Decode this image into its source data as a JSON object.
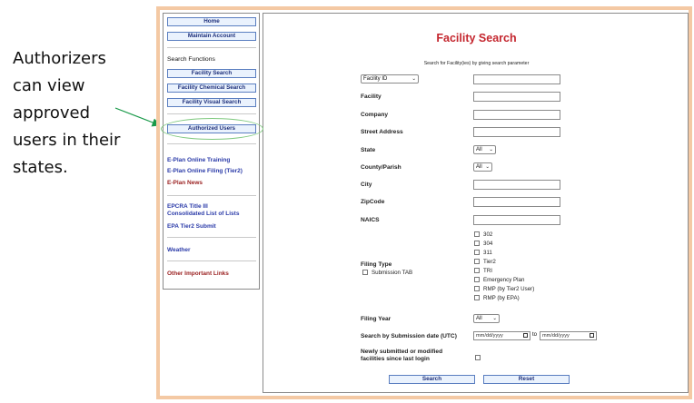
{
  "callout": {
    "lines": [
      "Authorizers",
      "can view",
      "approved",
      "users in their",
      "states."
    ]
  },
  "sidebar": {
    "home": "Home",
    "maintain_account": "Maintain Account",
    "search_functions_heading": "Search Functions",
    "facility_search": "Facility Search",
    "facility_chemical_search": "Facility Chemical Search",
    "facility_visual_search": "Facility Visual Search",
    "authorized_users": "Authorized Users",
    "links_group1": [
      "E-Plan Online Training",
      "E-Plan Online Filing (Tier2)",
      "E-Plan News"
    ],
    "epcra_line1": "EPCRA Title III",
    "epcra_line2": "Consolidated List of Lists",
    "epa_tier2": "EPA Tier2 Submit",
    "weather": "Weather",
    "other_links": "Other Important Links"
  },
  "form": {
    "title": "Facility Search",
    "subtitle": "Search for Facility(ies) by giving search parameter",
    "id_type_select": "Facility ID",
    "labels": {
      "facility": "Facility",
      "company": "Company",
      "street": "Street Address",
      "state": "State",
      "county": "County/Parish",
      "city": "City",
      "zip": "ZipCode",
      "naics": "NAICS",
      "filing_type": "Filing Type",
      "submission_tab": "Submission TAB",
      "filing_year": "Filing Year",
      "date_search": "Search by Submission date (UTC)",
      "newly_line1": "Newly submitted or modified",
      "newly_line2": "facilities since last login"
    },
    "state_value": "All",
    "county_value": "All",
    "filing_year_value": "All",
    "filing_types": [
      "302",
      "304",
      "311",
      "Tier2",
      "TRI",
      "Emergency Plan",
      "RMP (by Tier2 User)",
      "RMP (by EPA)"
    ],
    "date_from": "mm/dd/yyyy",
    "date_to_label": "to",
    "date_to": "mm/dd/yyyy",
    "search_button": "Search",
    "reset_button": "Reset"
  },
  "colors": {
    "frame": "#f4c9a4",
    "title": "#c4262e",
    "link": "#2a3aa8",
    "highlight": "#7fc97f",
    "arrow": "#1a9a4a"
  }
}
